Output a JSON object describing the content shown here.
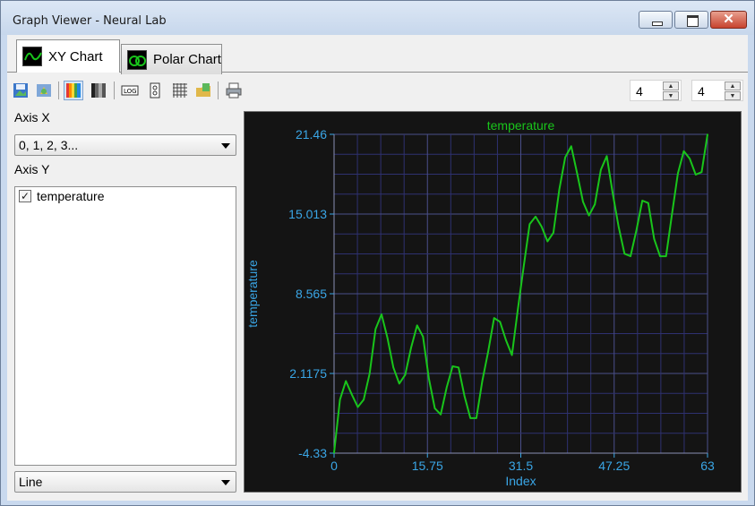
{
  "window": {
    "title": "Graph Viewer - Neural Lab"
  },
  "tabs": [
    {
      "label": "XY Chart",
      "icon": "xy-chart-icon"
    },
    {
      "label": "Polar Chart",
      "icon": "polar-chart-icon"
    }
  ],
  "spinners": {
    "left_value": "4",
    "right_value": "4"
  },
  "left_panel": {
    "axis_x_label": "Axis X",
    "axis_x_value": "0, 1, 2, 3...",
    "axis_y_label": "Axis Y",
    "series_items": [
      {
        "label": "temperature",
        "checked": true
      }
    ],
    "chart_style_value": "Line"
  },
  "colors": {
    "series": "#19c51b",
    "axis_text": "#3aa6e6",
    "grid": "#2e3170",
    "background": "#141414"
  },
  "chart_data": {
    "type": "line",
    "title": "temperature",
    "xlabel": "Index",
    "ylabel": "temperature",
    "xlim": [
      0,
      63
    ],
    "ylim": [
      -4.33,
      21.46
    ],
    "x_ticks": [
      "0",
      "15.75",
      "31.5",
      "47.25",
      "63"
    ],
    "y_ticks": [
      "-4.33",
      "2.1175",
      "8.565",
      "15.013",
      "21.46"
    ],
    "grid": true,
    "series": [
      {
        "name": "temperature",
        "x": [
          0,
          1,
          2,
          3,
          4,
          5,
          6,
          7,
          8,
          9,
          10,
          11,
          12,
          13,
          14,
          15,
          16,
          17,
          18,
          19,
          20,
          21,
          22,
          23,
          24,
          25,
          26,
          27,
          28,
          29,
          30,
          31,
          32,
          33,
          34,
          35,
          36,
          37,
          38,
          39,
          40,
          41,
          42,
          43,
          44,
          45,
          46,
          47,
          48,
          49,
          50,
          51,
          52,
          53,
          54,
          55,
          56,
          57,
          58,
          59,
          60,
          61,
          62,
          63
        ],
        "values": [
          -4.3,
          0.0,
          1.5,
          0.4,
          -0.6,
          0.0,
          2.1,
          5.7,
          6.9,
          5.0,
          2.6,
          1.3,
          2.0,
          4.2,
          6.0,
          5.1,
          1.7,
          -0.7,
          -1.2,
          1.0,
          2.7,
          2.6,
          0.3,
          -1.5,
          -1.5,
          1.5,
          3.9,
          6.6,
          6.3,
          4.8,
          3.6,
          7.3,
          10.8,
          14.2,
          14.8,
          14.0,
          12.8,
          13.5,
          17.0,
          19.6,
          20.5,
          18.3,
          16.0,
          14.9,
          15.8,
          18.6,
          19.7,
          16.7,
          14.0,
          11.8,
          11.6,
          13.7,
          16.1,
          15.9,
          13.0,
          11.6,
          11.6,
          15.0,
          18.3,
          20.1,
          19.5,
          18.2,
          18.4,
          21.46
        ]
      }
    ]
  }
}
